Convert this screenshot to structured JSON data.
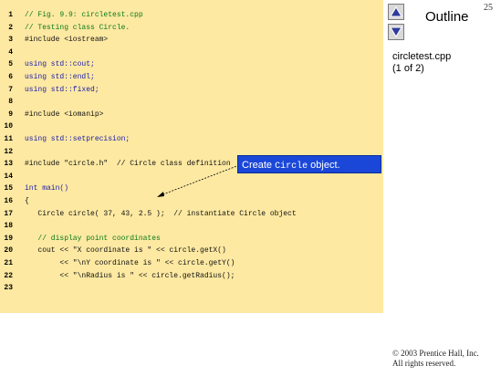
{
  "slide": {
    "page_number": "25",
    "outline_title": "Outline",
    "file_name": "circletest.cpp",
    "page_of": "(1 of 2)",
    "copyright_line1": "© 2003 Prentice Hall, Inc.",
    "copyright_line2": "All rights reserved."
  },
  "nav": {
    "up_icon": "triangle-up-icon",
    "down_icon": "triangle-down-icon"
  },
  "callout": {
    "prefix": "Create ",
    "mono": "Circle",
    "suffix": " object."
  },
  "code": {
    "lines": [
      {
        "num": "1",
        "text": "// Fig. 9.9: circletest.cpp"
      },
      {
        "num": "2",
        "text": "// Testing class Circle."
      },
      {
        "num": "3",
        "text": "#include <iostream>"
      },
      {
        "num": "4",
        "text": ""
      },
      {
        "num": "5",
        "text": "using std::cout;"
      },
      {
        "num": "6",
        "text": "using std::endl;"
      },
      {
        "num": "7",
        "text": "using std::fixed;"
      },
      {
        "num": "8",
        "text": ""
      },
      {
        "num": "9",
        "text": "#include <iomanip>"
      },
      {
        "num": "10",
        "text": ""
      },
      {
        "num": "11",
        "text": "using std::setprecision;"
      },
      {
        "num": "12",
        "text": ""
      },
      {
        "num": "13",
        "text": "#include \"circle.h\"  // Circle class definition"
      },
      {
        "num": "14",
        "text": ""
      },
      {
        "num": "15",
        "text": "int main()"
      },
      {
        "num": "16",
        "text": "{"
      },
      {
        "num": "17",
        "text": "   Circle circle( 37, 43, 2.5 );  // instantiate Circle object"
      },
      {
        "num": "18",
        "text": ""
      },
      {
        "num": "19",
        "text": "   // display point coordinates"
      },
      {
        "num": "20",
        "text": "   cout << \"X coordinate is \" << circle.getX()"
      },
      {
        "num": "21",
        "text": "        << \"\\nY coordinate is \" << circle.getY()"
      },
      {
        "num": "22",
        "text": "        << \"\\nRadius is \" << circle.getRadius();"
      },
      {
        "num": "23",
        "text": ""
      }
    ]
  },
  "colors": {
    "code_background": "#fde9a2",
    "callout_background": "#1b47d8",
    "comment": "#0b7a1a",
    "keyword": "#1c1ca8"
  }
}
